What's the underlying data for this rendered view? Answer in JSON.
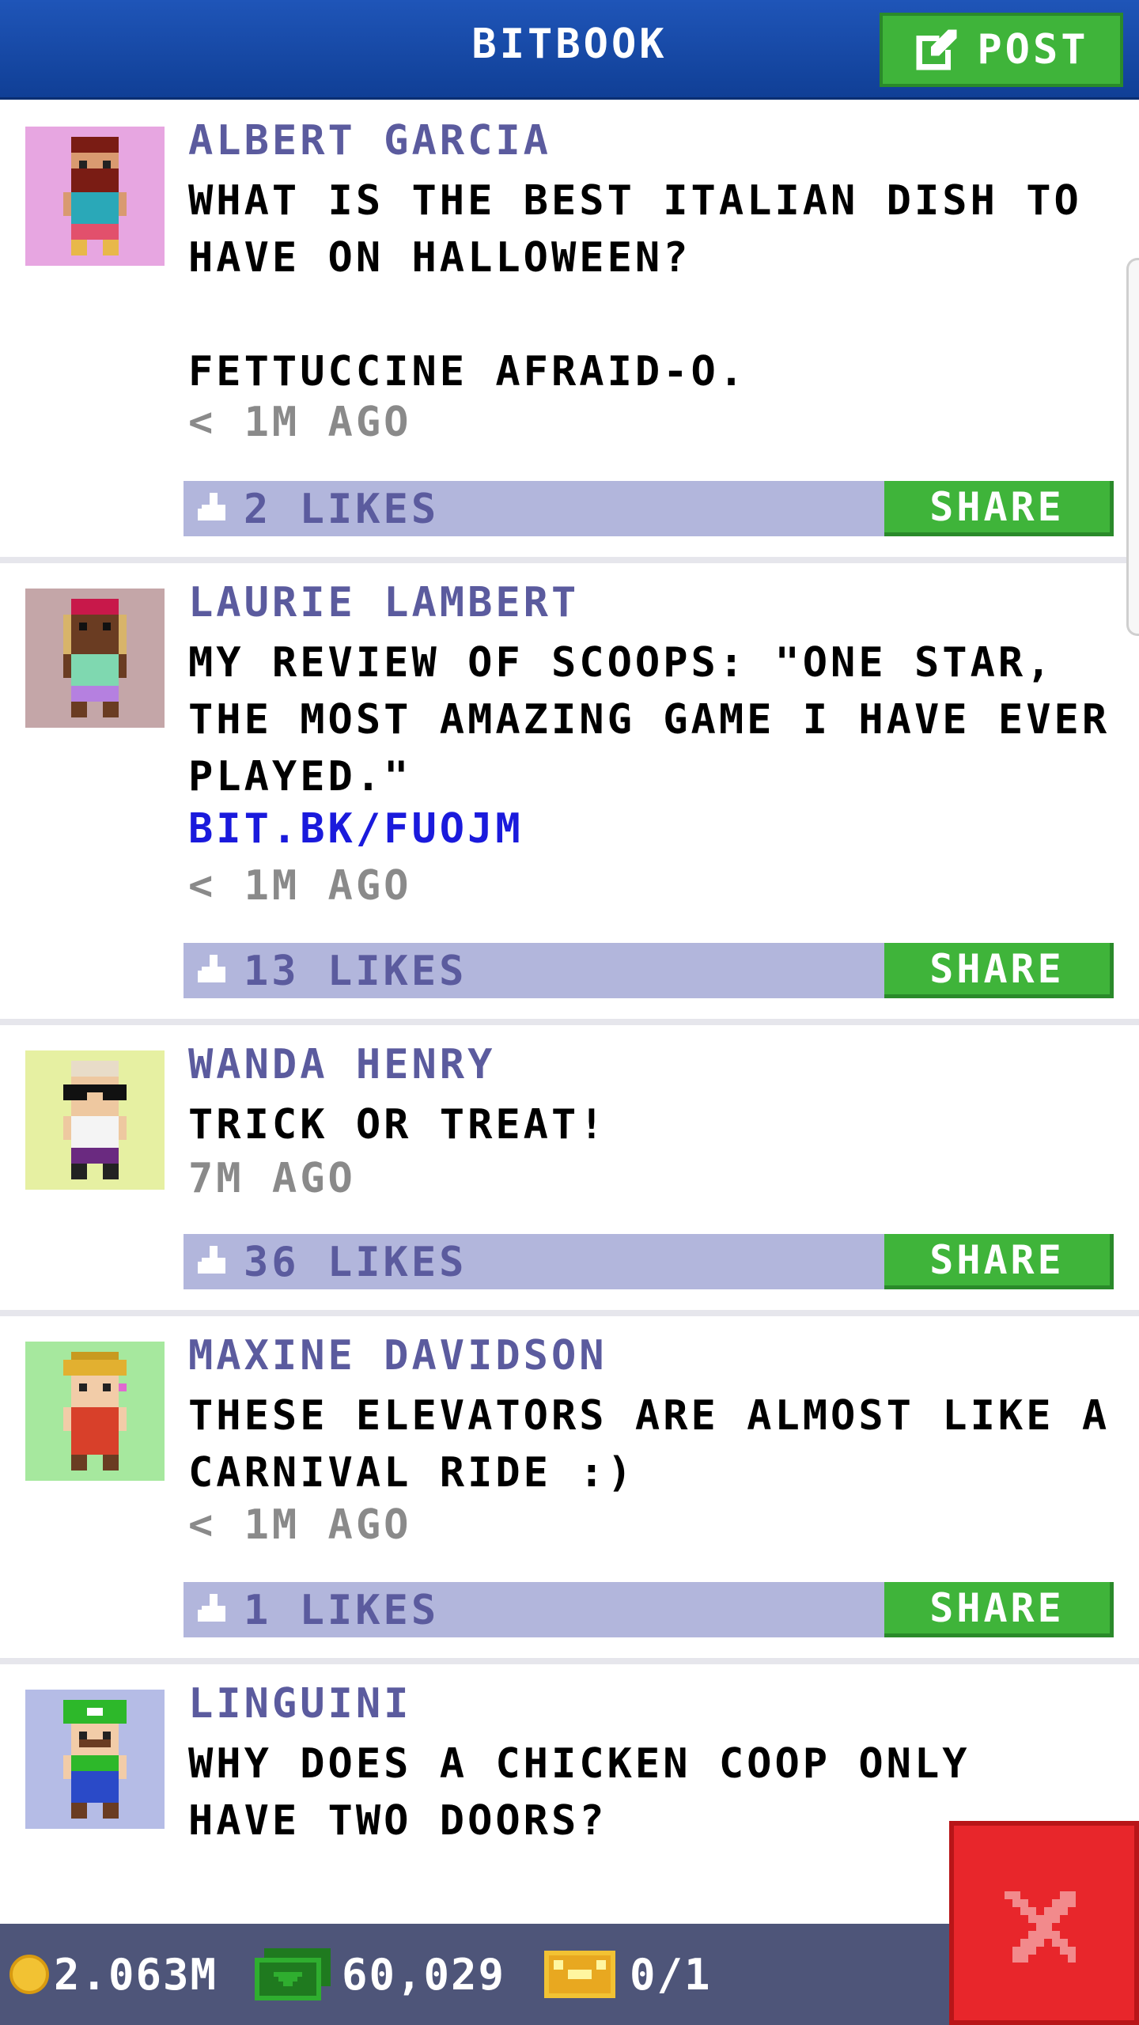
{
  "header": {
    "title": "BITBOOK",
    "post_label": "POST"
  },
  "posts": [
    {
      "author": "ALBERT GARCIA",
      "text": "WHAT IS THE BEST ITALIAN DISH TO\nHAVE ON HALLOWEEN?\n\nFETTUCCINE AFRAID-O.",
      "link": "",
      "time": "< 1M AGO",
      "likes": "2 LIKES",
      "share_label": "SHARE",
      "avatar_bg": "#e7a6e1"
    },
    {
      "author": "LAURIE LAMBERT",
      "text": "MY REVIEW OF SCOOPS: \"ONE STAR,\nTHE MOST AMAZING GAME I HAVE EVER\nPLAYED.\"",
      "link": "BIT.BK/FUOJM",
      "time": "< 1M AGO",
      "likes": "13 LIKES",
      "share_label": "SHARE",
      "avatar_bg": "#c4a6a8"
    },
    {
      "author": "WANDA HENRY",
      "text": "TRICK OR TREAT!",
      "link": "",
      "time": "7M AGO",
      "likes": "36 LIKES",
      "share_label": "SHARE",
      "avatar_bg": "#e6f0a2"
    },
    {
      "author": "MAXINE DAVIDSON",
      "text": "THESE ELEVATORS ARE ALMOST LIKE A\nCARNIVAL RIDE :)",
      "link": "",
      "time": "< 1M AGO",
      "likes": "1 LIKES",
      "share_label": "SHARE",
      "avatar_bg": "#a6e89e"
    },
    {
      "author": "LINGUINI",
      "text": "WHY DOES A CHICKEN COOP ONLY\nHAVE TWO DOORS?",
      "link": "",
      "time": "",
      "likes": "",
      "share_label": "",
      "avatar_bg": "#b5bce6"
    }
  ],
  "bottom_bar": {
    "coins": "2.063M",
    "bux": "60,029",
    "tickets": "0/1"
  },
  "colors": {
    "header_blue": "#1a4ea8",
    "accent_green": "#3fb43a",
    "like_bar": "#b2b6dc",
    "name_purple": "#5b5b9e",
    "link_blue": "#1a1adc",
    "close_red": "#e8262b"
  },
  "icons": {
    "post": "edit-icon",
    "like": "thumbs-up-icon",
    "coin": "coin-icon",
    "bux": "money-icon",
    "ticket": "ticket-icon",
    "close": "close-icon"
  }
}
